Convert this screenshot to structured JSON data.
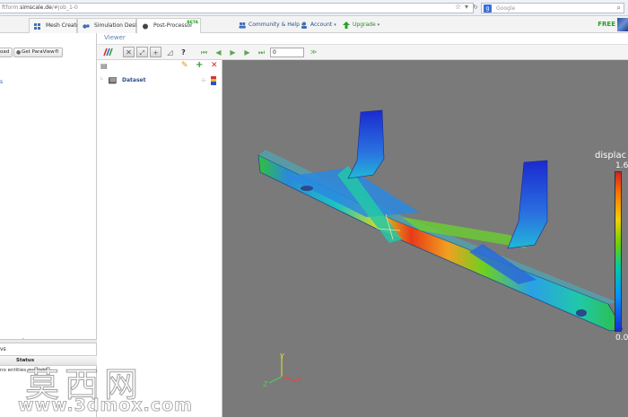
{
  "browser": {
    "url_prefix": "ftform.",
    "url_host": "simscale.de",
    "url_path": "/#job_1-0",
    "search_engine_icon": "google-icon",
    "search_placeholder": "Google"
  },
  "app_tabs": [
    {
      "label": "Mesh Creator",
      "icon": "grid-icon"
    },
    {
      "label": "Simulation Designer",
      "icon": "gears-icon"
    },
    {
      "label": "Post-Processor",
      "icon": "dot-icon",
      "badge": "BETA"
    }
  ],
  "nav": {
    "community_label": "Community & Help",
    "account_label": "Account",
    "upgrade_label": "Upgrade",
    "plan_label": "FREE"
  },
  "left_panel": {
    "load_button_label": "oad",
    "paraview_button_label": "Get ParaView®",
    "link_label": "s",
    "bottom_tab_label": "vs",
    "status_header": "Status",
    "status_empty": "no entities available"
  },
  "viewer": {
    "title": "Viewer",
    "frame_value": "0",
    "frame_go_label": "≫"
  },
  "pipeline": {
    "dataset_label": "Dataset"
  },
  "legend": {
    "title": "displac",
    "max_label": "1.6",
    "min_label": "0.0"
  },
  "axes": {
    "x": "X",
    "y": "Y",
    "z": "Z"
  },
  "colors": {
    "accent": "#2a4f8a",
    "free": "#25a12a",
    "viewport_bg": "#7a7a7a"
  },
  "watermark": {
    "cn_text": "莫西网",
    "url_text": "www.3dmox.com"
  }
}
